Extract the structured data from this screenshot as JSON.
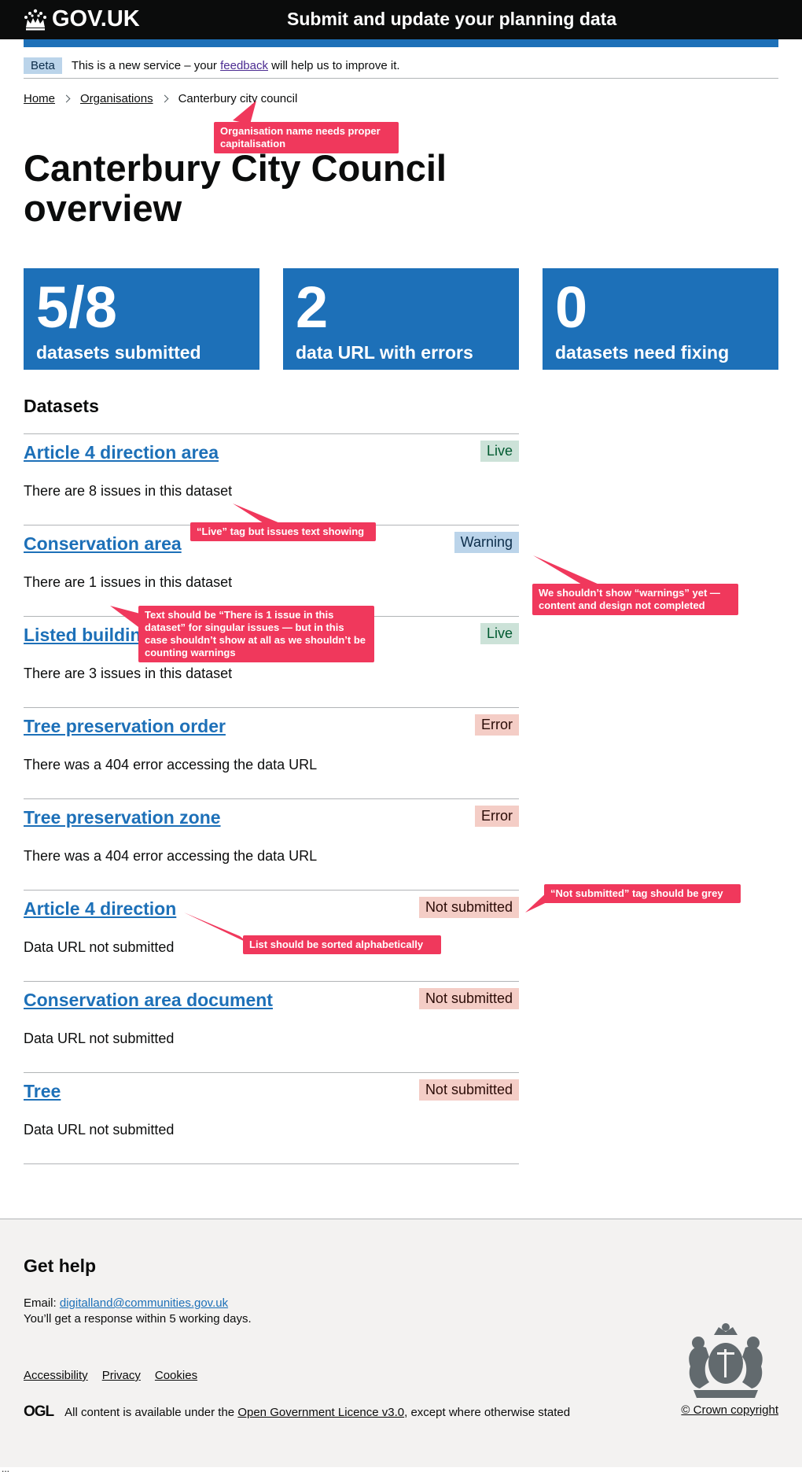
{
  "header": {
    "logo_text": "GOV.UK",
    "service_name": "Submit and update your planning data"
  },
  "phase_banner": {
    "tag": "Beta",
    "text_before": "This is a new service – your",
    "link": "feedback",
    "text_after": "will help us to improve it."
  },
  "breadcrumbs": [
    "Home",
    "Organisations",
    "Canterbury city council"
  ],
  "page_title": "Canterbury City Council overview",
  "stats": [
    {
      "number": "5/8",
      "label": "datasets submitted"
    },
    {
      "number": "2",
      "label": "data URL with errors"
    },
    {
      "number": "0",
      "label": "datasets need fixing"
    }
  ],
  "datasets_heading": "Datasets",
  "datasets": [
    {
      "name": "Article 4 direction area",
      "status": "Live",
      "description": "There are 8 issues in this dataset"
    },
    {
      "name": "Conservation area",
      "status": "Warning",
      "description": "There are 1 issues in this dataset"
    },
    {
      "name": "Listed building",
      "status": "Live",
      "description": "There are 3 issues in this dataset"
    },
    {
      "name": "Tree preservation order",
      "status": "Error",
      "description": "There was a 404 error accessing the data URL"
    },
    {
      "name": "Tree preservation zone",
      "status": "Error",
      "description": "There was a 404 error accessing the data URL"
    },
    {
      "name": "Article 4 direction",
      "status": "Not submitted",
      "description": "Data URL not submitted"
    },
    {
      "name": "Conservation area document",
      "status": "Not submitted",
      "description": "Data URL not submitted"
    },
    {
      "name": "Tree",
      "status": "Not submitted",
      "description": "Data URL not submitted"
    }
  ],
  "annotations": {
    "org_name": "Organisation name needs proper capitalisation",
    "live_tag": "“Live” tag but issues text showing",
    "warnings": "We shouldn’t show “warnings” yet — content and design not completed",
    "singular": "Text should be “There is 1 issue in this dataset” for singular issues — but in this case shouldn’t show at all as we shouldn’t be counting warnings",
    "not_submitted": "“Not submitted” tag should be grey",
    "sorted": "List should be sorted alphabetically"
  },
  "colors": {
    "annotation": "#f0385c",
    "brand_blue": "#1d70b8",
    "header_black": "#0b0c0c"
  },
  "footer": {
    "heading": "Get help",
    "email_label": "Email:",
    "email": "digitalland@communities.gov.uk",
    "response": "You’ll get a response within 5 working days.",
    "links": [
      "Accessibility",
      "Privacy",
      "Cookies"
    ],
    "ogl_logo": "OGL",
    "licence_before": "All content is available under the",
    "licence_link": "Open Government Licence v3.0",
    "licence_after": ", except where otherwise stated",
    "copyright": "© Crown copyright"
  },
  "page_end": "..."
}
